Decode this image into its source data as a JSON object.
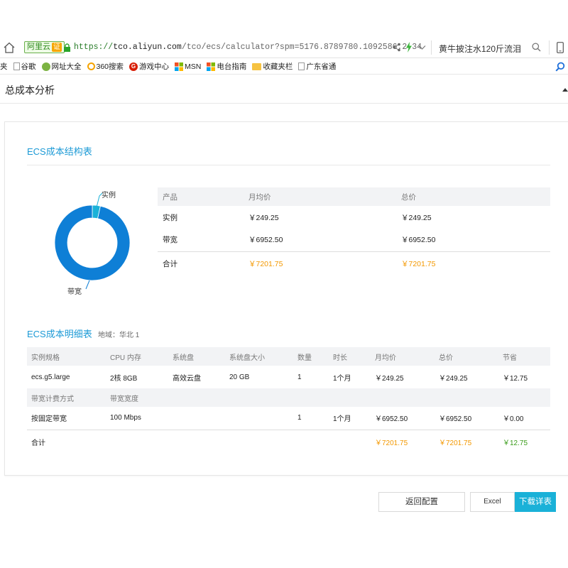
{
  "browser": {
    "cert_label": "阿里云",
    "cert_badge": "证",
    "url_scheme": "https://",
    "url_host": "tco.aliyun.com",
    "url_path": "/tco/ecs/calculator?spm=5176.8789780.1092586.2.34",
    "search_text": "黄牛披注水120斤流泪"
  },
  "favorites": {
    "items": [
      {
        "label": "夹",
        "icon": "none"
      },
      {
        "label": "谷歌",
        "icon": "page-icon"
      },
      {
        "label": "网址大全",
        "icon": "web-directory-icon"
      },
      {
        "label": "360搜索",
        "icon": "360-search-icon"
      },
      {
        "label": "游戏中心",
        "icon": "game-center-icon"
      },
      {
        "label": "MSN",
        "icon": "msn-icon"
      },
      {
        "label": "电台指南",
        "icon": "radio-guide-icon"
      },
      {
        "label": "收藏夹栏",
        "icon": "folder-icon"
      },
      {
        "label": "广东省通",
        "icon": "page-icon"
      }
    ]
  },
  "page": {
    "title": "总成本分析"
  },
  "structure": {
    "title": "ECS成本结构表",
    "donut_labels": {
      "instance": "实例",
      "bandwidth": "带宽"
    },
    "headers": [
      "产品",
      "月均价",
      "总价"
    ],
    "rows": [
      {
        "product": "实例",
        "monthly": "￥249.25",
        "total": "￥249.25"
      },
      {
        "product": "带宽",
        "monthly": "￥6952.50",
        "total": "￥6952.50"
      }
    ],
    "total_row": {
      "product": "合计",
      "monthly": "￥7201.75",
      "total": "￥7201.75"
    },
    "colors": {
      "instance": "#1ab1d8",
      "bandwidth": "#0e7fd6",
      "total": "#f39800"
    }
  },
  "chart_data": {
    "type": "pie",
    "categories": [
      "实例",
      "带宽"
    ],
    "values": [
      249.25,
      6952.5
    ]
  },
  "detail": {
    "title": "ECS成本明细表",
    "region": "地域：华北 1",
    "headers": [
      "实例规格",
      "CPU 内存",
      "系统盘",
      "系统盘大小",
      "数量",
      "时长",
      "月均价",
      "总价",
      "节省"
    ],
    "instance_row": {
      "spec": "ecs.g5.large",
      "cpu_mem": "2核 8GB",
      "disk": "高效云盘",
      "disk_size": "20 GB",
      "qty": "1",
      "duration": "1个月",
      "monthly": "￥249.25",
      "total": "￥249.25",
      "saving": "￥12.75"
    },
    "bw_headers": [
      "带宽计费方式",
      "带宽宽度"
    ],
    "bw_row": {
      "mode": "按固定带宽",
      "width": "100 Mbps",
      "qty": "1",
      "duration": "1个月",
      "monthly": "￥6952.50",
      "total": "￥6952.50",
      "saving": "￥0.00"
    },
    "total_row": {
      "label": "合计",
      "monthly": "￥7201.75",
      "total": "￥7201.75",
      "saving": "￥12.75"
    }
  },
  "buttons": {
    "back": "返回配置",
    "excel": "Excel",
    "download": "下载详表"
  }
}
